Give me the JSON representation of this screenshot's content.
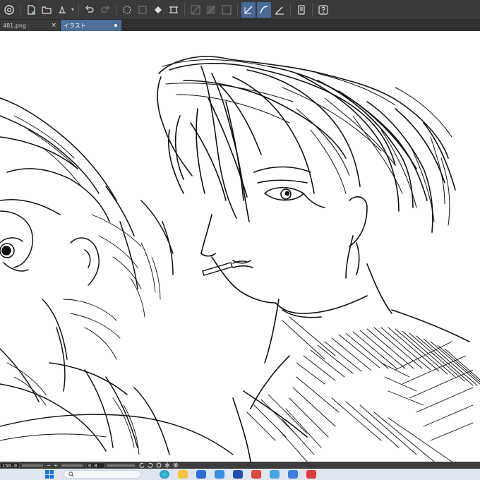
{
  "toolbar": {
    "icons": [
      "clip-studio-logo-icon",
      "new-file-icon",
      "open-folder-icon",
      "save-icon",
      "undo-icon",
      "redo-icon",
      "transform-icon",
      "clear-icon",
      "fill-icon",
      "select-icon",
      "snap-ruler-icon",
      "snap-grid-icon",
      "snap-perspective-icon",
      "vector-line-icon",
      "vector-curve-icon",
      "ruler-pen-icon",
      "tablet-icon",
      "help-icon"
    ],
    "active_tool": "vector-curve-icon",
    "accent_color": "#4a6b9a"
  },
  "tabs": [
    {
      "label": "481.png",
      "close": "×",
      "active": false
    },
    {
      "label": "イラスト",
      "active": true
    }
  ],
  "canvas": {
    "content": "pen line-art sketch of two figures; central figure holding a cigarette"
  },
  "statusbar": {
    "zoom_value": "150.0",
    "zoom_minus": "−",
    "zoom_plus": "+",
    "rotate_value": "0.0"
  },
  "taskbar": {
    "search_placeholder": ""
  }
}
